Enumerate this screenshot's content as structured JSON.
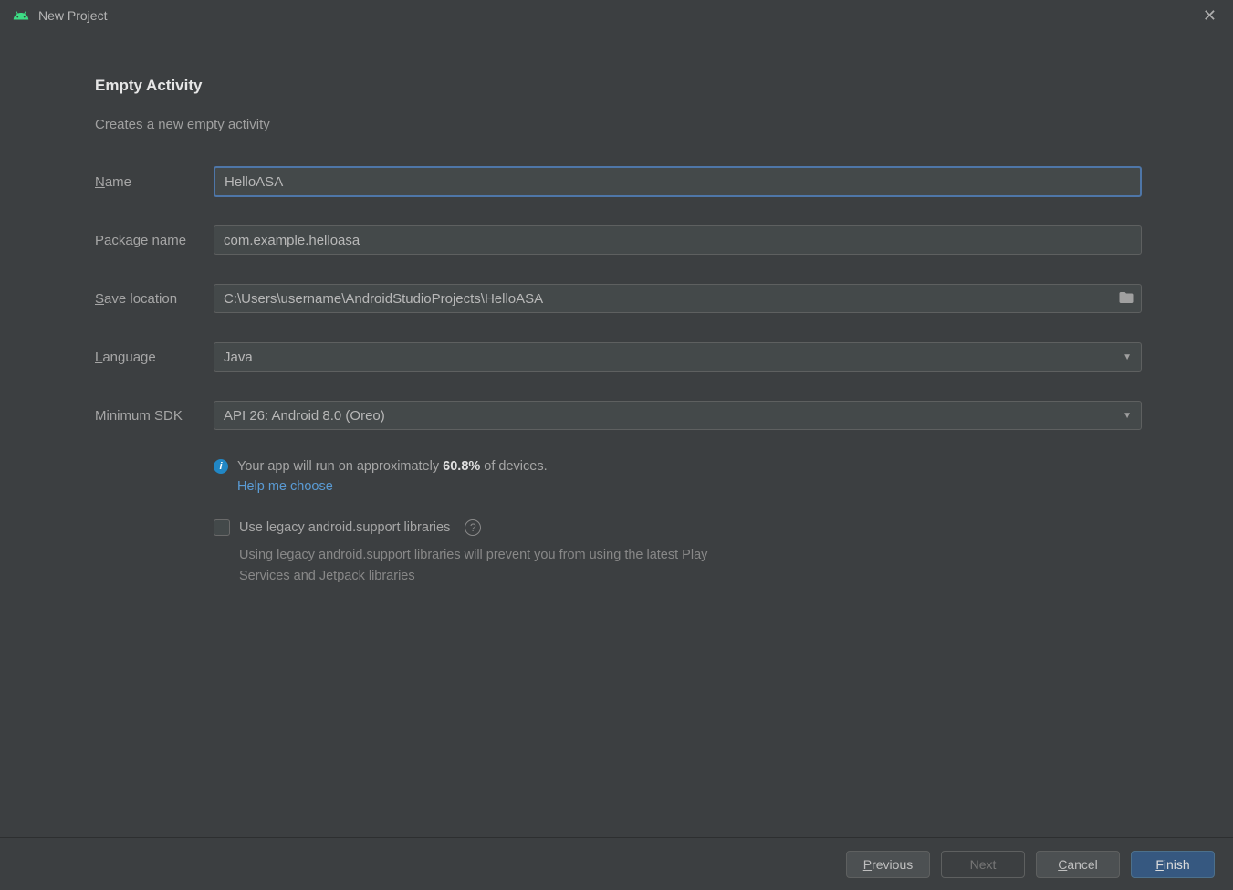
{
  "window": {
    "title": "New Project"
  },
  "heading": "Empty Activity",
  "subtitle": "Creates a new empty activity",
  "labels": {
    "name": "ame",
    "package": "ackage name",
    "save": "ave location",
    "language": "anguage",
    "minsdk": "Minimum SDK"
  },
  "fields": {
    "name": "HelloASA",
    "package": "com.example.helloasa",
    "save": "C:\\Users\\username\\AndroidStudioProjects\\HelloASA",
    "language": "Java",
    "minsdk": "API 26: Android 8.0 (Oreo)"
  },
  "info": {
    "pre": "Your app will run on approximately ",
    "pct": "60.8%",
    "post": " of devices.",
    "help_link": "Help me choose"
  },
  "legacy": {
    "label": "Use legacy android.support libraries",
    "note": "Using legacy android.support libraries will prevent you from using the latest Play Services and Jetpack libraries"
  },
  "buttons": {
    "previous": "revious",
    "next": "Next",
    "cancel": "ancel",
    "finish": "inish"
  }
}
